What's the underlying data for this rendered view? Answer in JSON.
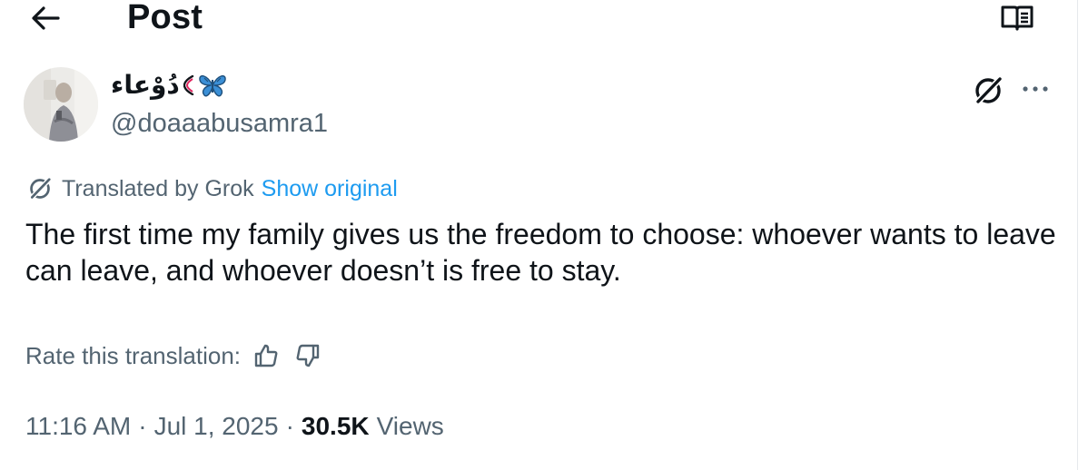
{
  "header": {
    "title": "Post",
    "back_icon": "arrow-left-icon",
    "reader_icon": "open-book-icon"
  },
  "author": {
    "display_name": "دُوْعاء",
    "name_emojis": [
      "butterfly-icon",
      "watermelon-slice-icon"
    ],
    "handle": "@doaaabusamra1"
  },
  "actions": {
    "grok_icon": "grok-icon",
    "more_icon": "more-dots-icon"
  },
  "translation": {
    "label": "Translated by Grok",
    "show_original": "Show original"
  },
  "post": {
    "text": "The first time my family gives us the freedom to choose: whoever wants to leave can leave, and whoever doesn’t is free to stay."
  },
  "rating": {
    "label": "Rate this translation:",
    "icons": [
      "thumbs-up-icon",
      "thumbs-down-icon"
    ]
  },
  "meta": {
    "time": "11:16 AM",
    "separator": "·",
    "date": "Jul 1, 2025",
    "views_count": "30.5K",
    "views_label": "Views"
  },
  "colors": {
    "text_primary": "#0f1419",
    "text_secondary": "#536471",
    "link": "#1d9bf0",
    "butterfly": "#3b8fd6"
  }
}
